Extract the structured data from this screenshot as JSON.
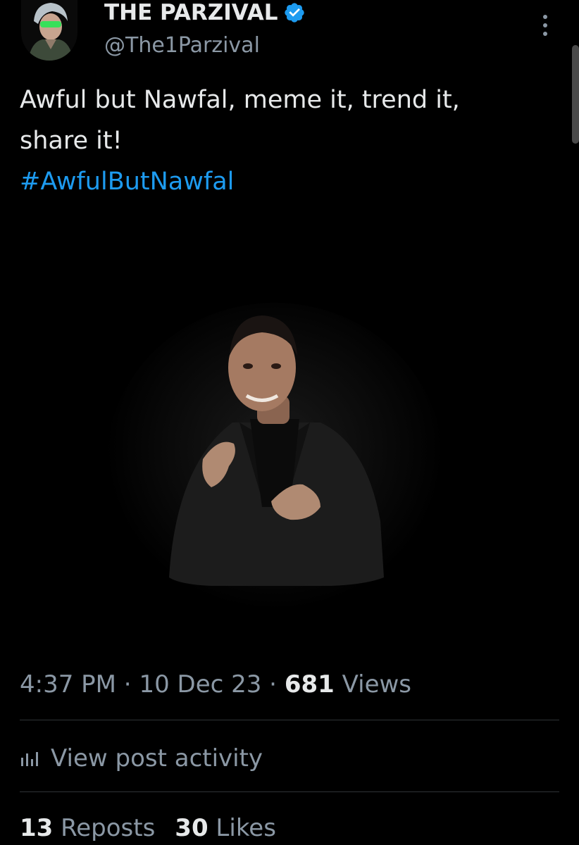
{
  "author": {
    "display_name": "THE PARZIVAL",
    "handle": "@The1Parzival",
    "verified_icon": "verified-badge-icon",
    "verified_color": "#1d9bf0"
  },
  "tweet": {
    "text_line1": "Awful but Nawfal, meme it, trend it,",
    "text_line2": "share it!",
    "hashtag": "#AwfulButNawfal",
    "hashtag_color": "#1d9bf0"
  },
  "meta": {
    "time": "4:37 PM",
    "sep1": " · ",
    "date": "10 Dec 23",
    "sep2": " · ",
    "views_count": "681",
    "views_label": " Views"
  },
  "activity": {
    "icon": "analytics-icon",
    "label": "View post activity"
  },
  "stats": {
    "reposts_count": "13",
    "reposts_label": " Reposts",
    "likes_count": "30",
    "likes_label": " Likes"
  },
  "colors": {
    "background": "#000000",
    "primary_text": "#e7e9ea",
    "secondary_text": "#8b98a5",
    "divider": "#2f3336"
  }
}
